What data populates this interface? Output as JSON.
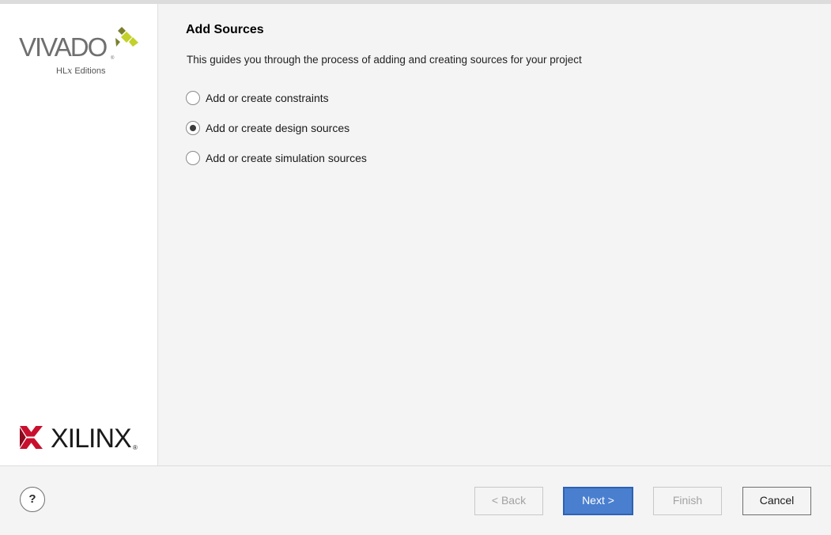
{
  "branding": {
    "vivado_wordmark": "VIVADO",
    "vivado_trademark": "®",
    "vivado_edition_prefix": "HL",
    "vivado_edition_x": "x",
    "vivado_edition_suffix": " Editions",
    "xilinx_wordmark": "XILINX",
    "xilinx_registered": "®",
    "leaf_colors": [
      "#c3d12b",
      "#7a7f2c"
    ],
    "xilinx_color": "#c8102e"
  },
  "page": {
    "title": "Add Sources",
    "subtitle": "This guides you through the process of adding and creating sources for your project"
  },
  "options": [
    {
      "label": "Add or create constraints",
      "checked": false
    },
    {
      "label": "Add or create design sources",
      "checked": true
    },
    {
      "label": "Add or create simulation sources",
      "checked": false
    }
  ],
  "footer": {
    "help_label": "?",
    "back_label": "< Back",
    "next_label": "Next >",
    "finish_label": "Finish",
    "cancel_label": "Cancel"
  },
  "colors": {
    "primary_button": "#4a7fcf",
    "background": "#f4f4f4"
  }
}
